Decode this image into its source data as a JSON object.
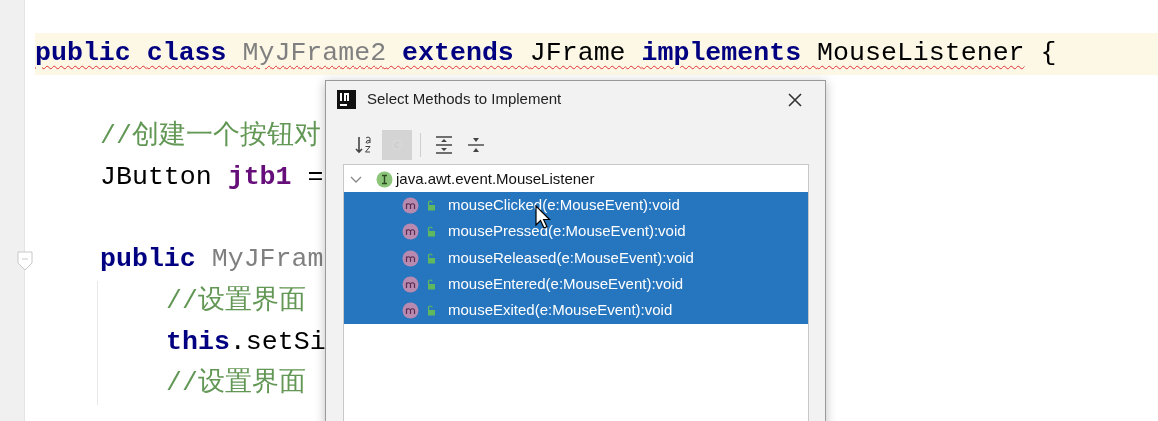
{
  "editor": {
    "lines": [
      {
        "kind": "blank"
      },
      {
        "kind": "code",
        "current": true,
        "tokens": [
          {
            "kind": "keyword",
            "text": "public",
            "error": true
          },
          {
            "kind": "keyword",
            "text": "class",
            "error": true
          },
          {
            "kind": "unused",
            "text": "MyJFrame2",
            "error": true
          },
          {
            "kind": "keyword",
            "text": "extends",
            "error": true
          },
          {
            "kind": "plain",
            "text": "JFrame",
            "error": true
          },
          {
            "kind": "keyword",
            "text": "implements",
            "error": true
          },
          {
            "kind": "plain",
            "text": "MouseListener",
            "error": true
          },
          {
            "kind": "plain",
            "text": "{",
            "error": false
          }
        ],
        "children": [
          {
            "kind": "blank"
          },
          {
            "kind": "code",
            "tokens": [
              {
                "kind": "comment",
                "text": "//创建一个按钮对"
              }
            ]
          },
          {
            "kind": "code",
            "tokens": [
              {
                "kind": "plain",
                "text": "JButton"
              },
              {
                "kind": "field",
                "text": "jtb1"
              },
              {
                "kind": "plain",
                "text": "="
              }
            ]
          },
          {
            "kind": "blank"
          },
          {
            "kind": "code",
            "foldable": true,
            "tokens": [
              {
                "kind": "keyword",
                "text": "public"
              },
              {
                "kind": "unused",
                "text": "MyJFram"
              }
            ],
            "children": [
              {
                "kind": "code",
                "tokens": [
                  {
                    "kind": "comment",
                    "text": "//设置界面"
                  }
                ]
              },
              {
                "kind": "code",
                "tokens": [
                  {
                    "kind": "keyword",
                    "text": "this"
                  },
                  {
                    "kind": "plain",
                    "text": ".setSi",
                    "attached": true
                  }
                ]
              },
              {
                "kind": "code",
                "tokens": [
                  {
                    "kind": "comment",
                    "text": "//设置界面"
                  }
                ]
              }
            ]
          }
        ]
      }
    ]
  },
  "dialog": {
    "title": "Select Methods to Implement",
    "toolbar": [
      {
        "kind": "sort",
        "selected": false
      },
      {
        "kind": "classes",
        "selected": true
      },
      {
        "kind": "separator"
      },
      {
        "kind": "expand",
        "selected": false
      },
      {
        "kind": "collapse",
        "selected": false
      }
    ],
    "tree": [
      {
        "label": "java.awt.event.MouseListener",
        "expanded": true,
        "selected": false,
        "children": [
          {
            "label": "mouseClicked(e:MouseEvent):void",
            "selected": true
          },
          {
            "label": "mousePressed(e:MouseEvent):void",
            "selected": true
          },
          {
            "label": "mouseReleased(e:MouseEvent):void",
            "selected": true
          },
          {
            "label": "mouseEntered(e:MouseEvent):void",
            "selected": true
          },
          {
            "label": "mouseExited(e:MouseEvent):void",
            "selected": true
          }
        ]
      }
    ]
  }
}
